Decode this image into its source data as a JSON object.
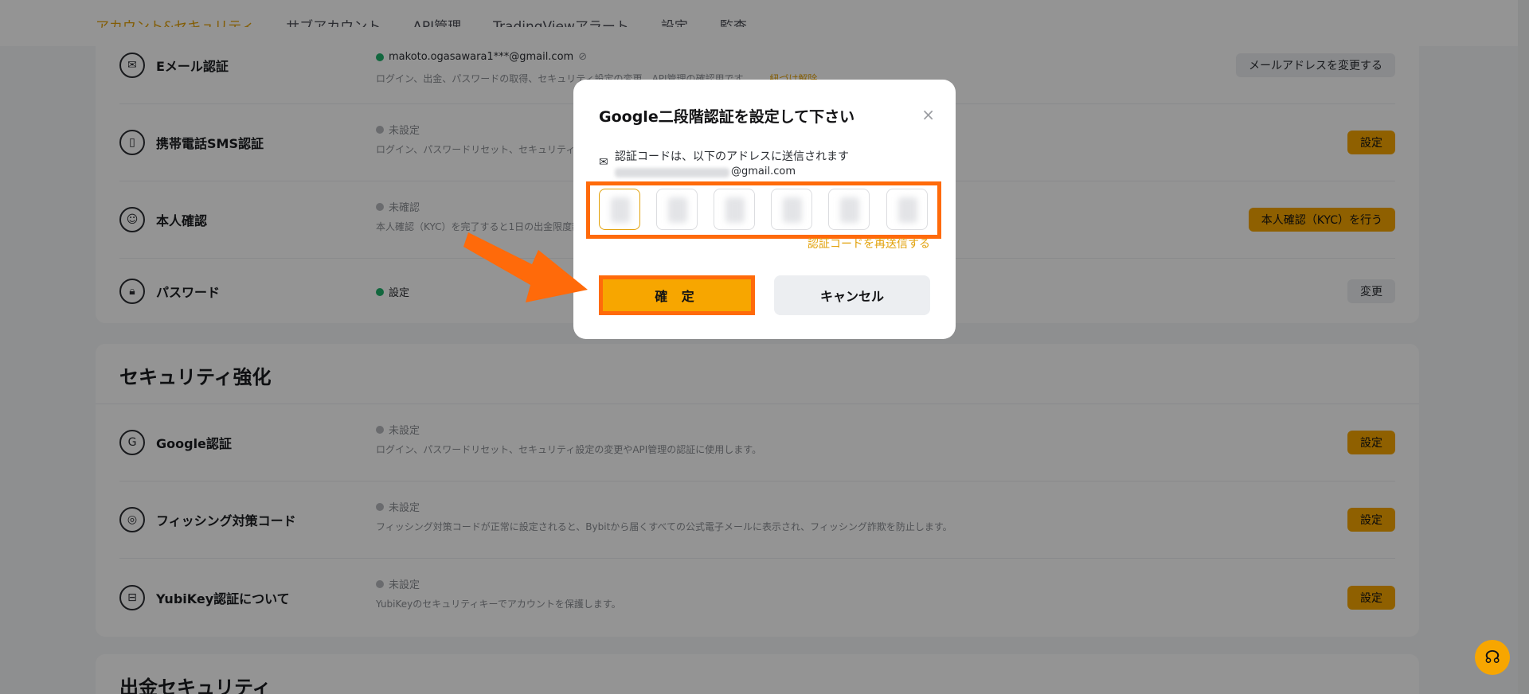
{
  "nav": {
    "tabs": [
      "アカウント&セキュリティ",
      "サブアカウント",
      "API管理",
      "TradingViewアラート",
      "設定",
      "監査"
    ]
  },
  "account_rows": [
    {
      "title": "Eメール認証",
      "icon": "mail-icon",
      "status": "makoto.ogasawara1***@gmail.com",
      "desc": "ログイン、出金、パスワードの取得、セキュリティ設定の変更、API管理の確認用です。",
      "link": "紐づけ解除",
      "button": "メールアドレスを変更する"
    },
    {
      "title": "携帯電話SMS認証",
      "icon": "phone-icon",
      "status": "未設定",
      "desc": "ログイン、パスワードリセット、セキュリティ",
      "button": "設定"
    },
    {
      "title": "本人確認",
      "icon": "id-card-icon",
      "status": "未確認",
      "desc": "本人確認（KYC）を完了すると1日の出金限度額",
      "button": "本人確認（KYC）を行う"
    },
    {
      "title": "パスワード",
      "icon": "lock-icon",
      "status": "設定",
      "desc": "",
      "button": "変更"
    }
  ],
  "security": {
    "section_title": "セキュリティ強化",
    "rows": [
      {
        "title": "Google認証",
        "icon": "google-icon",
        "status": "未設定",
        "desc": "ログイン、パスワードリセット、セキュリティ設定の変更やAPI管理の認証に使用します。",
        "button": "設定"
      },
      {
        "title": "フィッシング対策コード",
        "icon": "anti-phishing-icon",
        "status": "未設定",
        "desc": "フィッシング対策コードが正常に設定されると、Bybitから届くすべての公式電子メールに表示され、フィッシング詐欺を防止します。",
        "button": "設定"
      },
      {
        "title": "YubiKey認証について",
        "icon": "yubikey-icon",
        "status": "未設定",
        "desc": "YubiKeyのセキュリティキーでアカウントを保護します。",
        "button": "設定"
      }
    ]
  },
  "withdraw": {
    "section_title": "出金セキュリティ"
  },
  "modal": {
    "title": "Google二段階認証を設定して下さい",
    "close": "×",
    "notice": "認証コードは、以下のアドレスに送信されます",
    "email": "@gmail.com",
    "resend": "認証コードを再送信する",
    "confirm": "確 定",
    "cancel": "キャンセル"
  },
  "colors": {
    "accent": "#f7a600",
    "highlight": "#ff6a0a"
  }
}
